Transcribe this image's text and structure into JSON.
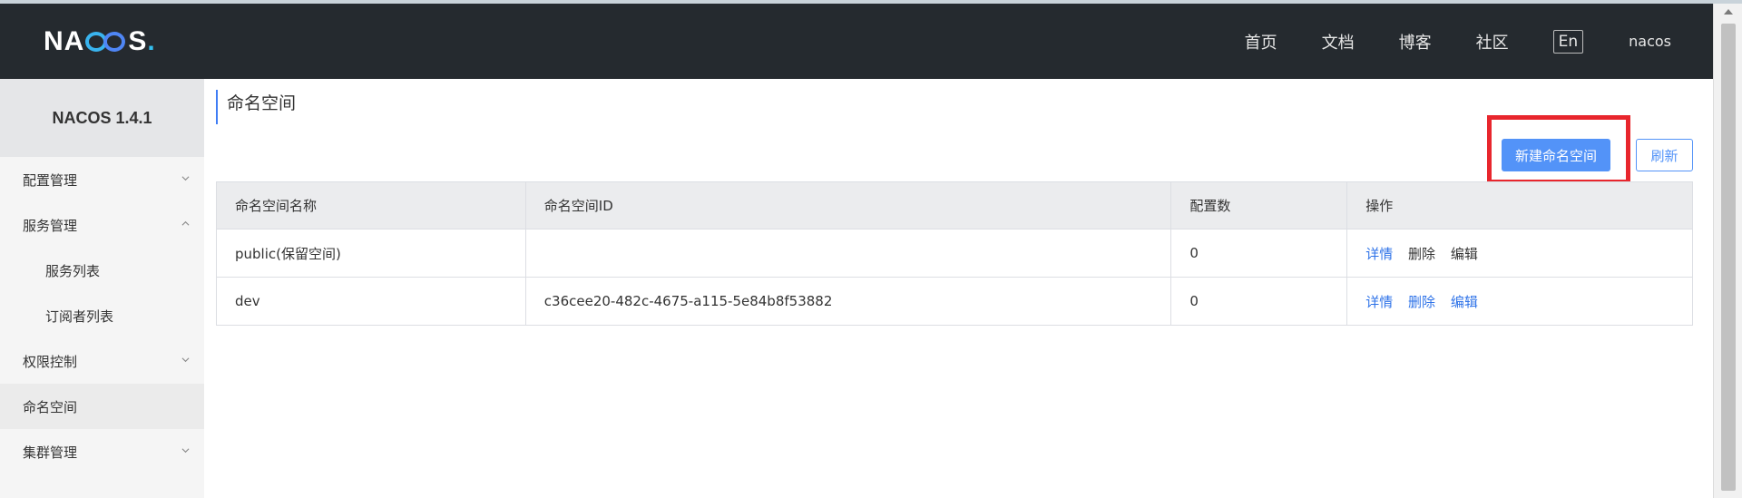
{
  "header": {
    "logo_text_left": "NA",
    "logo_text_right": "S",
    "nav": [
      "首页",
      "文档",
      "博客",
      "社区"
    ],
    "lang": "En",
    "user": "nacos"
  },
  "sidebar": {
    "version": "NACOS 1.4.1",
    "items": [
      {
        "label": "配置管理"
      },
      {
        "label": "服务管理"
      },
      {
        "label": "服务列表"
      },
      {
        "label": "订阅者列表"
      },
      {
        "label": "权限控制"
      },
      {
        "label": "命名空间"
      },
      {
        "label": "集群管理"
      }
    ]
  },
  "main": {
    "title": "命名空间",
    "create_button": "新建命名空间",
    "refresh_button": "刷新",
    "highlight_color": "#e8262d",
    "table": {
      "headers": [
        "命名空间名称",
        "命名空间ID",
        "配置数",
        "操作"
      ],
      "rows": [
        {
          "name": "public(保留空间)",
          "id": "",
          "count": "0",
          "ops": [
            "详情",
            "删除",
            "编辑"
          ]
        },
        {
          "name": "dev",
          "id": "c36cee20-482c-4675-a115-5e84b8f53882",
          "count": "0",
          "ops": [
            "详情",
            "删除",
            "编辑"
          ]
        }
      ]
    }
  },
  "colors": {
    "accent": "#5393f8",
    "link": "#2f73e8",
    "header_bg": "#252a2f"
  }
}
